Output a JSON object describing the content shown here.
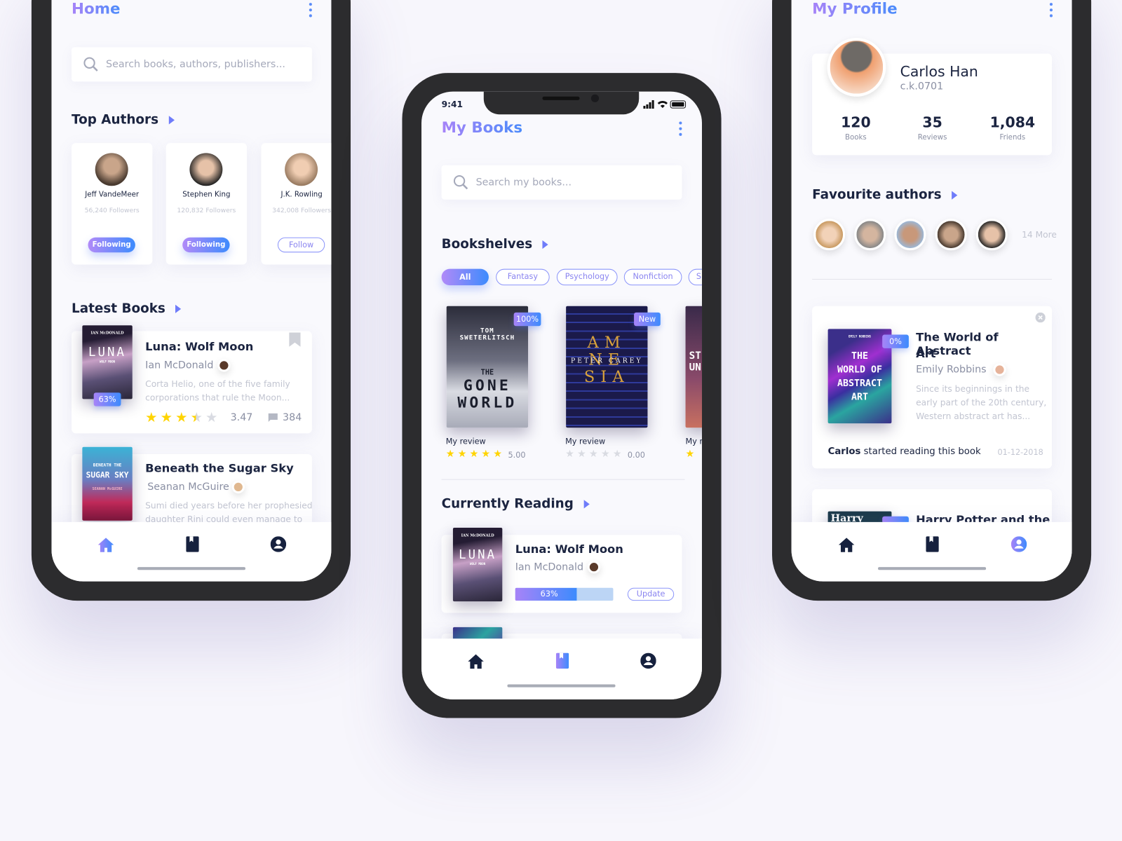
{
  "colors": {
    "accent_start": "#a783f8",
    "accent_end": "#3d8bfd",
    "text_dark": "#1b2440",
    "star": "#ffd400",
    "frame": "#2c2c2e"
  },
  "home": {
    "title": "Home",
    "search_placeholder": "Search books, authors, publishers...",
    "top_authors_label": "Top Authors",
    "authors": [
      {
        "name": "Jeff VandeMeer",
        "followers": "56,240 Followers",
        "button": "Following",
        "following": true
      },
      {
        "name": "Stephen King",
        "followers": "120,832 Followers",
        "button": "Following",
        "following": true
      },
      {
        "name": "J.K. Rowling",
        "followers": "342,008 Followers",
        "button": "Follow",
        "following": false
      }
    ],
    "latest_books_label": "Latest Books",
    "books": [
      {
        "title": "Luna: Wolf Moon",
        "author": "Ian McDonald",
        "desc1": "Corta Helio, one of the five family",
        "desc2": "corporations that rule the Moon...",
        "progress": "63%",
        "rating": 3.47,
        "rating_text": "3.47",
        "comments": "384",
        "cover_author": "IAN McDONALD",
        "cover_title": "LUNA",
        "cover_sub": "WOLF MOON"
      },
      {
        "title": "Beneath the Sugar Sky",
        "author": "Seanan McGuire",
        "desc1": "Sumi died years before her prophesied",
        "desc2": "daughter Rini could even manage to",
        "cover_title": "SUGAR SKY",
        "cover_top": "BENEATH THE",
        "cover_author": "SEANAN McGUIRE"
      }
    ],
    "nav": [
      {
        "icon": "home-icon",
        "active": true
      },
      {
        "icon": "book-icon",
        "active": false
      },
      {
        "icon": "profile-icon",
        "active": false
      }
    ]
  },
  "mybooks": {
    "status_time": "9:41",
    "title": "My Books",
    "search_placeholder": "Search my books...",
    "bookshelves_label": "Bookshelves",
    "chips": [
      {
        "label": "All",
        "active": true
      },
      {
        "label": "Fantasy"
      },
      {
        "label": "Psychology"
      },
      {
        "label": "Nonfiction"
      },
      {
        "label": "S"
      }
    ],
    "shelf": [
      {
        "badge": "100%",
        "review_label": "My review",
        "rating": 5,
        "rating_text": "5.00",
        "cover_author": "TOM SWETERLITSCH",
        "cover_title1": "THE",
        "cover_title2": "GONE",
        "cover_title3": "WORLD"
      },
      {
        "badge": "New",
        "review_label": "My review",
        "rating": 0,
        "rating_text": "0.00",
        "cover_title": "AMNESIA",
        "cover_author": "PETER CAREY"
      },
      {
        "review_label": "My re",
        "cover_title": "ST UN"
      }
    ],
    "currently_reading_label": "Currently Reading",
    "current": {
      "title": "Luna: Wolf Moon",
      "author": "Ian McDonald",
      "progress": 63,
      "progress_text": "63%",
      "update_label": "Update"
    },
    "nav": [
      {
        "icon": "home-icon",
        "active": false
      },
      {
        "icon": "book-icon",
        "active": true
      },
      {
        "icon": "profile-icon",
        "active": false
      }
    ]
  },
  "profile": {
    "title": "My Profile",
    "name": "Carlos Han",
    "handle": "c.k.0701",
    "stats": [
      {
        "value": "120",
        "label": "Books"
      },
      {
        "value": "35",
        "label": "Reviews"
      },
      {
        "value": "1,084",
        "label": "Friends"
      }
    ],
    "favourite_label": "Favourite authors",
    "more": "14 More",
    "activity": {
      "title1": "The World of Abstract",
      "title2": "Art",
      "author": "Emily Robbins",
      "badge": "0%",
      "desc1": "Since its beginnings in the",
      "desc2": "early part of the 20th century,",
      "desc3": "Western abstract art has...",
      "actor": "Carlos",
      "action": " started reading this book",
      "date": "01-12-2018",
      "cover_title": "THE WORLD OF ABSTRACT ART",
      "cover_author": "EMILY ROBBINS"
    },
    "activity2": {
      "title": "Harry Potter and the",
      "cover_title": "Harry Pott"
    },
    "nav": [
      {
        "icon": "home-icon",
        "active": false
      },
      {
        "icon": "book-icon",
        "active": false
      },
      {
        "icon": "profile-icon",
        "active": true
      }
    ]
  }
}
